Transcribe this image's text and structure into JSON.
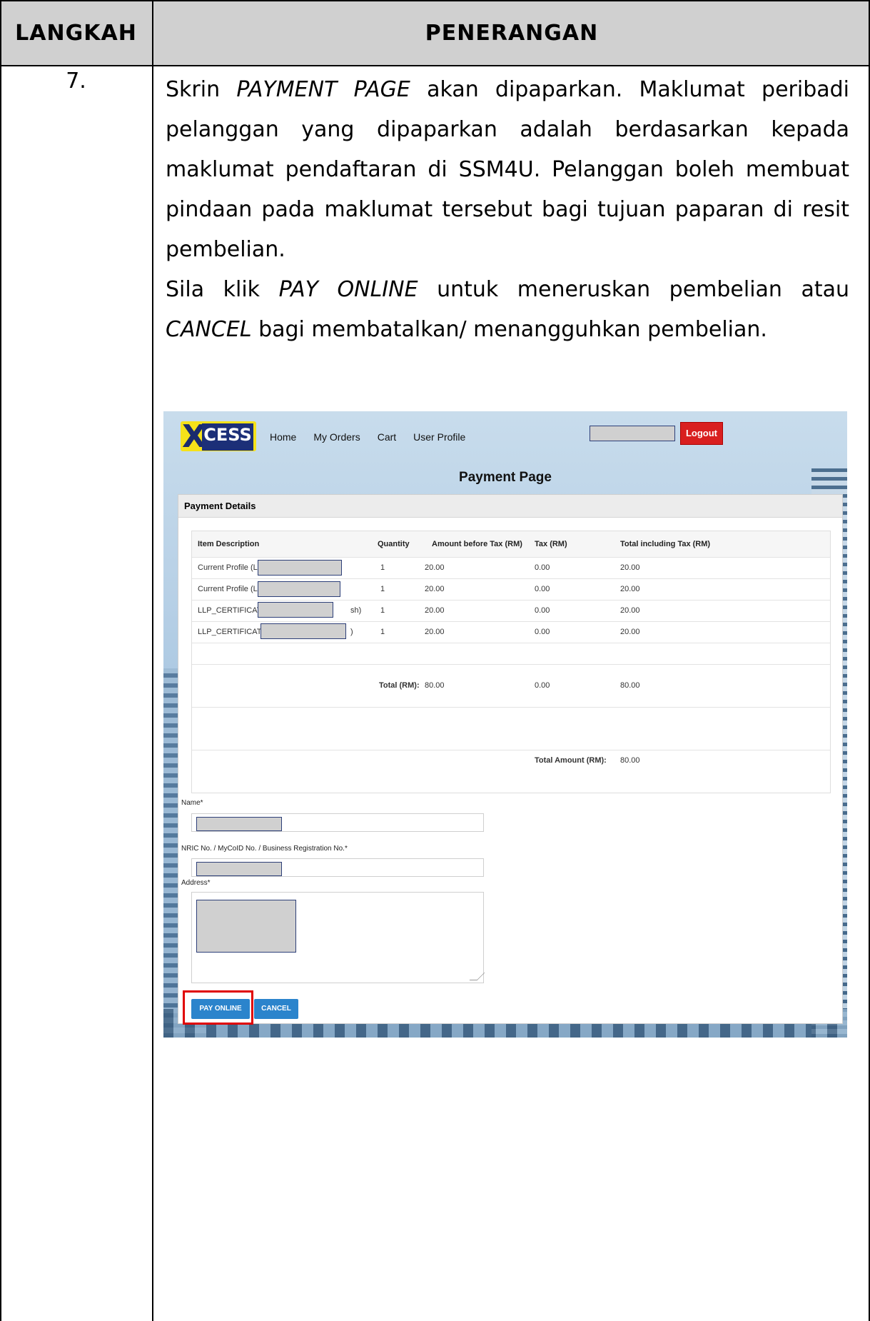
{
  "header": {
    "step_col": "LANGKAH",
    "desc_col": "PENERANGAN"
  },
  "row": {
    "step": "7.",
    "para1_a": "Skrin ",
    "para1_em": "PAYMENT PAGE",
    "para1_b": " akan dipaparkan. Maklumat peribadi pelanggan yang dipaparkan adalah berdasarkan kepada maklumat pendaftaran di SSM4U. Pelanggan boleh membuat pindaan pada maklumat tersebut bagi tujuan paparan di resit pembelian.",
    "para2_a": "Sila klik ",
    "para2_em1": "PAY ONLINE",
    "para2_b": " untuk meneruskan pembelian atau ",
    "para2_em2": "CANCEL",
    "para2_c": " bagi membatalkan/ menangguhkan pembelian."
  },
  "screenshot": {
    "logo_text": "CESS",
    "nav": [
      "Home",
      "My Orders",
      "Cart",
      "User Profile"
    ],
    "logout_label": "Logout",
    "page_title": "Payment Page",
    "panel_title": "Payment Details",
    "columns": [
      "Item Description",
      "Quantity",
      "Amount before Tax (RM)",
      "Tax (RM)",
      "Total including Tax (RM)"
    ],
    "items": [
      {
        "desc_prefix": "Current Profile (L",
        "desc_suffix": "",
        "qty": "1",
        "amount": "20.00",
        "tax": "0.00",
        "total": "20.00"
      },
      {
        "desc_prefix": "Current Profile (L",
        "desc_suffix": "",
        "qty": "1",
        "amount": "20.00",
        "tax": "0.00",
        "total": "20.00"
      },
      {
        "desc_prefix": "LLP_CERTIFICAT",
        "desc_suffix": "sh)",
        "qty": "1",
        "amount": "20.00",
        "tax": "0.00",
        "total": "20.00"
      },
      {
        "desc_prefix": "LLP_CERTIFICATE",
        "desc_suffix": ")",
        "qty": "1",
        "amount": "20.00",
        "tax": "0.00",
        "total": "20.00"
      }
    ],
    "total_label": "Total (RM):",
    "total_amount": "80.00",
    "total_tax": "0.00",
    "total_incl": "80.00",
    "grand_label": "Total Amount (RM):",
    "grand_value": "80.00",
    "name_label": "Name*",
    "nric_label": "NRIC No. / MyCoID No. / Business Registration No.*",
    "address_label": "Address*",
    "pay_label": "PAY ONLINE",
    "cancel_label": "CANCEL",
    "highlight_color": "#e00000"
  }
}
